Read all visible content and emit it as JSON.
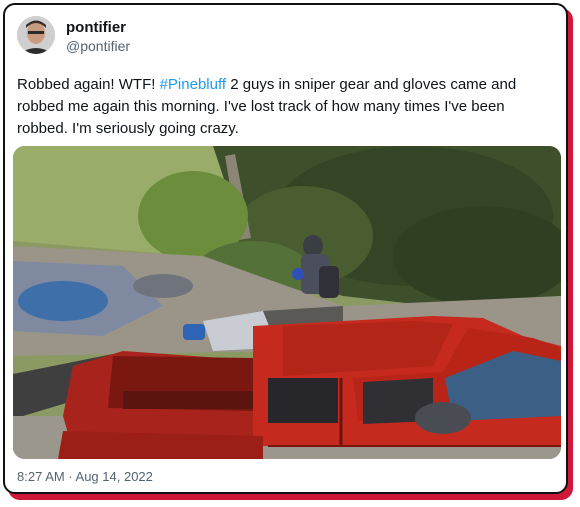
{
  "author": {
    "name": "pontifier",
    "handle": "@pontifier"
  },
  "tweet": {
    "text_before": "Robbed again! WTF! ",
    "hashtag": "#Pinebluff",
    "text_after": " 2 guys in sniper gear and gloves came and robbed me again this morning. I've lost track of how many times I've been robbed. I'm seriously going crazy.",
    "timestamp": "8:27 AM · Aug 14, 2022"
  },
  "colors": {
    "link": "#1d9bf0",
    "accent_shadow": "#d0183b",
    "truck_red": "#c62a1e"
  }
}
